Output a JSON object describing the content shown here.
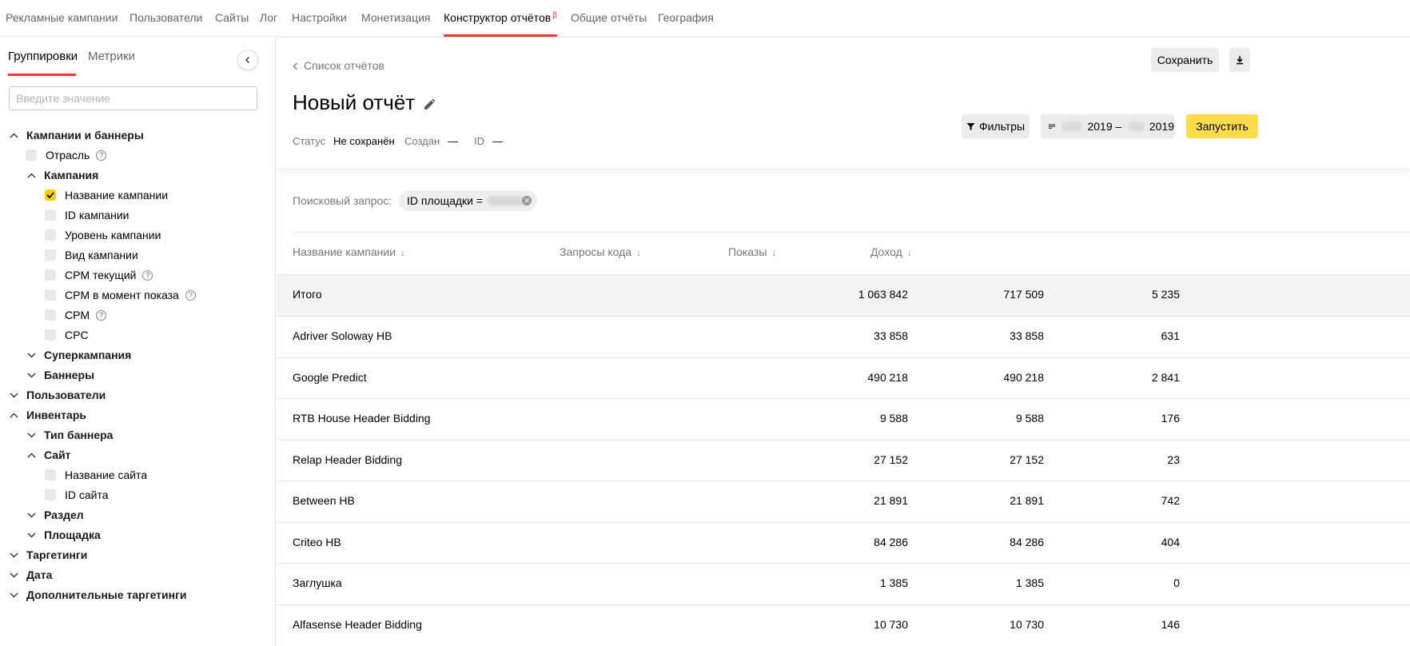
{
  "topnav": {
    "items": [
      {
        "label": "Рекламные кампании"
      },
      {
        "label": "Пользователи"
      },
      {
        "label": "Сайты"
      },
      {
        "label": "Лог"
      },
      {
        "label": "Настройки"
      },
      {
        "label": "Монетизация"
      },
      {
        "label": "Конструктор отчётов",
        "badge": "β",
        "active": true
      },
      {
        "label": "Общие отчёты"
      },
      {
        "label": "География"
      }
    ]
  },
  "sidebar": {
    "tabs": [
      {
        "label": "Группировки",
        "active": true
      },
      {
        "label": "Метрики"
      }
    ],
    "search_placeholder": "Введите значение",
    "tree": [
      {
        "label": "Кампании и баннеры",
        "type": "group",
        "expanded": true
      },
      {
        "label": "Отрасль",
        "type": "checkbox",
        "checked": false,
        "help": true
      },
      {
        "label": "Кампания",
        "type": "group",
        "expanded": true
      },
      {
        "label": "Название кампании",
        "type": "checkbox",
        "checked": true
      },
      {
        "label": "ID кампании",
        "type": "checkbox",
        "checked": false
      },
      {
        "label": "Уровень кампании",
        "type": "checkbox",
        "checked": false
      },
      {
        "label": "Вид кампании",
        "type": "checkbox",
        "checked": false
      },
      {
        "label": "CPM текущий",
        "type": "checkbox",
        "checked": false,
        "help": true
      },
      {
        "label": "CPM в момент показа",
        "type": "checkbox",
        "checked": false,
        "help": true
      },
      {
        "label": "CPM",
        "type": "checkbox",
        "checked": false,
        "help": true
      },
      {
        "label": "CPC",
        "type": "checkbox",
        "checked": false
      },
      {
        "label": "Суперкампания",
        "type": "group",
        "expanded": false
      },
      {
        "label": "Баннеры",
        "type": "group",
        "expanded": false
      },
      {
        "label": "Пользователи",
        "type": "group",
        "expanded": false
      },
      {
        "label": "Инвентарь",
        "type": "group",
        "expanded": true
      },
      {
        "label": "Тип баннера",
        "type": "group",
        "expanded": false
      },
      {
        "label": "Сайт",
        "type": "group",
        "expanded": true
      },
      {
        "label": "Название сайта",
        "type": "checkbox",
        "checked": false
      },
      {
        "label": "ID сайта",
        "type": "checkbox",
        "checked": false
      },
      {
        "label": "Раздел",
        "type": "group",
        "expanded": false
      },
      {
        "label": "Площадка",
        "type": "group",
        "expanded": false
      },
      {
        "label": "Таргетинги",
        "type": "group",
        "expanded": false
      },
      {
        "label": "Дата",
        "type": "group",
        "expanded": false
      },
      {
        "label": "Дополнительные таргетинги",
        "type": "group",
        "expanded": false
      }
    ]
  },
  "main": {
    "back_label": "Список отчётов",
    "title": "Новый отчёт",
    "status_key": "Статус",
    "status_value": "Не сохранён",
    "created_key": "Создан",
    "created_value": "—",
    "id_key": "ID",
    "id_value": "—",
    "save_label": "Сохранить",
    "filters_label": "Фильтры",
    "date_from": "2019 –",
    "date_to": "2019",
    "run_label": "Запустить",
    "query_label": "Поисковый запрос:",
    "query_chip": "ID площадки ="
  },
  "table": {
    "columns": [
      {
        "label": "Название кампании"
      },
      {
        "label": "Запросы кода"
      },
      {
        "label": "Показы"
      },
      {
        "label": "Доход"
      }
    ],
    "total": {
      "name": "Итого",
      "requests": "1 063 842",
      "shows": "717 509",
      "income": "5 235"
    },
    "rows": [
      {
        "name": "Adriver Soloway HB",
        "requests": "33 858",
        "shows": "33 858",
        "income": "631"
      },
      {
        "name": "Google Predict",
        "requests": "490 218",
        "shows": "490 218",
        "income": "2 841"
      },
      {
        "name": "RTB House Header Bidding",
        "requests": "9 588",
        "shows": "9 588",
        "income": "176"
      },
      {
        "name": "Relap Header Bidding",
        "requests": "27 152",
        "shows": "27 152",
        "income": "23"
      },
      {
        "name": "Between HB",
        "requests": "21 891",
        "shows": "21 891",
        "income": "742"
      },
      {
        "name": "Criteo HB",
        "requests": "84 286",
        "shows": "84 286",
        "income": "404"
      },
      {
        "name": "Заглушка",
        "requests": "1 385",
        "shows": "1 385",
        "income": "0"
      },
      {
        "name": "Alfasense Header Bidding",
        "requests": "10 730",
        "shows": "10 730",
        "income": "146"
      }
    ]
  },
  "colors": {
    "accent": "#ff3333",
    "run_button": "#ffdb4d",
    "checkbox_checked": "#ffcc00"
  }
}
